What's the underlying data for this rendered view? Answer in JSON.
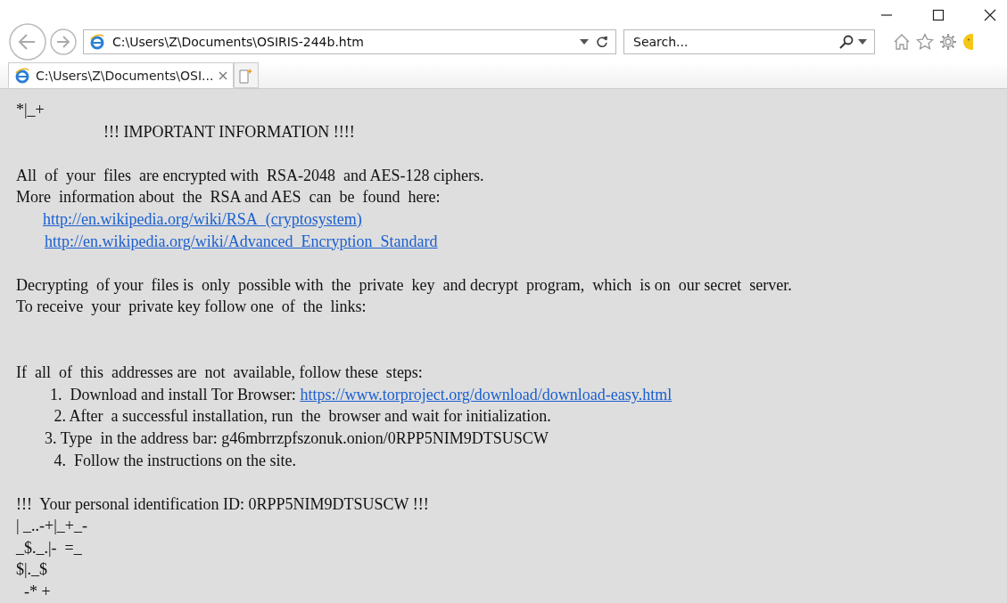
{
  "address_bar": {
    "url": "C:\\Users\\Z\\Documents\\OSIRIS-244b.htm"
  },
  "search": {
    "placeholder": "Search..."
  },
  "tabs": [
    {
      "title": "C:\\Users\\Z\\Documents\\OSI...",
      "selected": true
    }
  ],
  "page": {
    "lines": [
      {
        "kind": "ascii",
        "text": "*|_+"
      },
      {
        "kind": "heading",
        "text": "!!! IMPORTANT INFORMATION !!!!"
      },
      {
        "kind": "blank"
      },
      {
        "kind": "text",
        "text": "All  of  your  files  are encrypted with  RSA-2048  and AES-128 ciphers."
      },
      {
        "kind": "text",
        "text": "More  information about  the  RSA and AES  can  be  found  here:"
      },
      {
        "kind": "link",
        "link": "http://en.wikipedia.org/wiki/RSA_(cryptosystem)"
      },
      {
        "kind": "link2",
        "link": "http://en.wikipedia.org/wiki/Advanced_Encryption_Standard"
      },
      {
        "kind": "blank"
      },
      {
        "kind": "text",
        "text": "Decrypting  of your  files is  only  possible with  the  private  key  and decrypt  program,  which  is on  our secret  server."
      },
      {
        "kind": "text",
        "text": "To receive  your  private key follow one  of  the  links:"
      },
      {
        "kind": "blank"
      },
      {
        "kind": "blank"
      },
      {
        "kind": "text",
        "text": "If  all  of  this  addresses are  not  available, follow these  steps:"
      },
      {
        "kind": "step",
        "text": "1.  Download and install Tor Browser: ",
        "link": "https://www.torproject.org/download/download-easy.html"
      },
      {
        "kind": "step",
        "text": " 2. After  a successful installation, run  the  browser and wait for initialization."
      },
      {
        "kind": "step3",
        "text": "3. Type  in the address bar: g46mbrrzpfszonuk.onion/0RPP5NIM9DTSUSCW"
      },
      {
        "kind": "step",
        "text": " 4.  Follow the instructions on the site."
      },
      {
        "kind": "blank"
      },
      {
        "kind": "text",
        "text": "!!!  Your personal identification ID: 0RPP5NIM9DTSUSCW !!!"
      },
      {
        "kind": "ascii",
        "text": "| _..-+|_+_-"
      },
      {
        "kind": "ascii",
        "text": "_$._.|-  =_"
      },
      {
        "kind": "ascii",
        "text": "$|._$"
      },
      {
        "kind": "ascii",
        "text": "  -* +"
      }
    ]
  }
}
